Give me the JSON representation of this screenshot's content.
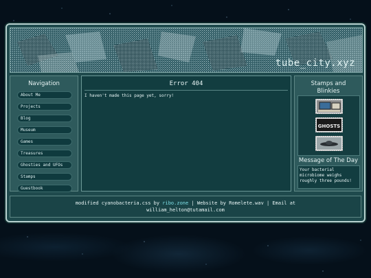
{
  "site": {
    "title": "tube_city.xyz"
  },
  "nav": {
    "heading": "Navigation",
    "items": [
      {
        "label": "About Me"
      },
      {
        "label": "Projects"
      },
      {
        "label": "Blog"
      },
      {
        "label": "Museum"
      },
      {
        "label": "Games"
      },
      {
        "label": "Treasures"
      },
      {
        "label": "Ghosties and UFOs"
      },
      {
        "label": "Stamps"
      },
      {
        "label": "Guestbook"
      }
    ]
  },
  "main": {
    "heading": "Error 404",
    "message": "I haven't made this page yet, sorry!"
  },
  "side": {
    "stamps_heading": "Stamps and Blinkies",
    "stamps": [
      {
        "icon": "computer-stamp-icon"
      },
      {
        "icon": "ghosts-stamp-icon",
        "text": "GHOSTS"
      },
      {
        "icon": "ufo-stamp-icon"
      }
    ],
    "motd_heading": "Message of The Day",
    "motd": "Your bacterial microbiome weighs roughly three pounds!"
  },
  "footer": {
    "prefix": "modified cyanobacteria.css by ",
    "link1": "ribo.zone",
    "middle": " | Website by Romelete.wav | Email at",
    "email": "william_helton@tutamail.com"
  },
  "colors": {
    "frame": "#1f4a4d",
    "accent_link": "#7fe0e8"
  }
}
